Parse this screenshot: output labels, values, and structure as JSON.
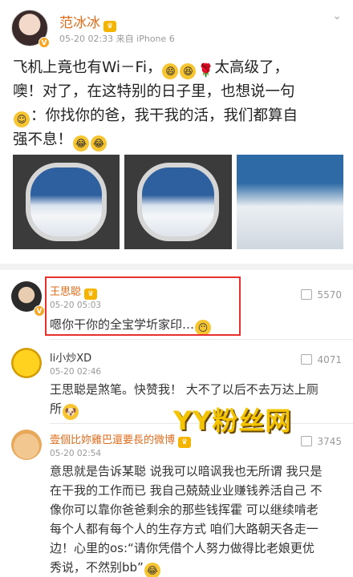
{
  "post": {
    "username": "范冰冰",
    "meta": "05-20 02:33  来自 iPhone 6",
    "text_1": "飞机上竟也有Wi－Fi，",
    "text_2": "太高级了，",
    "text_3": "噢！对了，在这特别的日子里，也想说一句",
    "text_4": "：你找你的爸，我干我的活，我们都算自",
    "text_5": "强不息！",
    "emoji_rose": "🌹"
  },
  "comments": [
    {
      "username": "王思聪",
      "time": "05-20 05:03",
      "text": "嗯你干你的全宝学圻家印…",
      "likes": "5570"
    },
    {
      "username": "li小炒XD",
      "time": "05-20 02:46",
      "text_1": "王思聪是煞笔。快赞我！ 大不了以后不去万达上厕",
      "text_2": "所",
      "likes": "4071"
    },
    {
      "username": "壹個比妳雞巴還要長的微博",
      "time": "05-20 02:54",
      "lines": [
        "意思就是告诉某聪 说我可以暗讽我也无所谓 我只是",
        "在干我的工作而已 我自己兢兢业业赚钱养活自己 不",
        "像你可以靠你爸爸剩余的那些钱挥霍 可以继续啃老",
        "每个人都有每个人的生存方式 咱们大路朝天各走一",
        "边！心里的os:“请你凭借个人努力做得比老娘更优",
        "秀说，不然别bb”"
      ],
      "likes": "3745"
    }
  ],
  "watermark": "YY粉丝网",
  "colors": {
    "accent": "#e06c1c",
    "highlight": "#e8302e"
  }
}
